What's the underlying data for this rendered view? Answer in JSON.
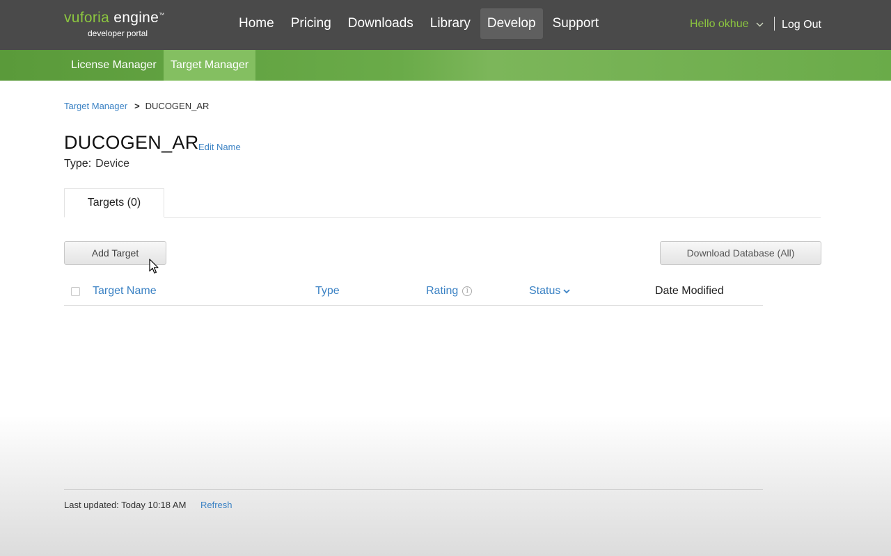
{
  "brand": {
    "logo_prefix": "vuforia",
    "logo_suffix": "engine",
    "logo_mark": "™",
    "logo_sub": "developer portal"
  },
  "nav": {
    "items": [
      {
        "label": "Home",
        "active": false
      },
      {
        "label": "Pricing",
        "active": false
      },
      {
        "label": "Downloads",
        "active": false
      },
      {
        "label": "Library",
        "active": false
      },
      {
        "label": "Develop",
        "active": true
      },
      {
        "label": "Support",
        "active": false
      }
    ],
    "greeting": "Hello okhue",
    "logout": "Log Out"
  },
  "subnav": {
    "items": [
      {
        "label": "License Manager",
        "active": false
      },
      {
        "label": "Target Manager",
        "active": true
      }
    ]
  },
  "breadcrumb": {
    "parent": "Target Manager",
    "separator": ">",
    "current": "DUCOGEN_AR"
  },
  "database": {
    "name": "DUCOGEN_AR",
    "edit_label": "Edit Name",
    "type_label": "Type:",
    "type_value": "Device"
  },
  "tabs": [
    {
      "label": "Targets (0)",
      "active": true
    }
  ],
  "actions": {
    "add_target": "Add Target",
    "download_db": "Download Database (All)"
  },
  "table": {
    "columns": {
      "name": "Target Name",
      "type": "Type",
      "rating": "Rating",
      "status": "Status",
      "date_modified": "Date Modified"
    },
    "rows": []
  },
  "footer": {
    "last_updated": "Last updated: Today 10:18 AM",
    "refresh": "Refresh"
  },
  "colors": {
    "nav_bg": "#4a4a4a",
    "brand_green": "#8cc63f",
    "subnav_green": "#6aab49",
    "link_blue": "#3b82c4"
  }
}
